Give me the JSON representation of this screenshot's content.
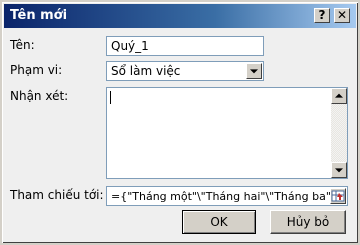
{
  "window": {
    "title": "Tên mới"
  },
  "titlebar": {
    "help_glyph": "?",
    "close_glyph": "✕"
  },
  "form": {
    "name_label": "Tên:",
    "name_value": "Quý_1",
    "scope_label": "Phạm vi:",
    "scope_value": "Sổ làm việc",
    "comment_label": "Nhận xét:",
    "comment_value": "",
    "refers_label": "Tham chiếu tới:",
    "refers_value": "={\"Tháng một\"\\\"Tháng hai\"\\\"Tháng ba\"}"
  },
  "buttons": {
    "ok_label": "OK",
    "cancel_label": "Hủy bỏ"
  },
  "icons": {
    "help": "question-mark-icon",
    "close": "close-x-icon",
    "combo": "chevron-down-icon",
    "scroll_up": "arrow-up-icon",
    "scroll_down": "arrow-down-icon",
    "collapse": "range-select-icon"
  },
  "colors": {
    "title_start": "#0a246a",
    "title_end": "#a6caf0",
    "face": "#d4d0c8",
    "field_border": "#7f9db9"
  }
}
